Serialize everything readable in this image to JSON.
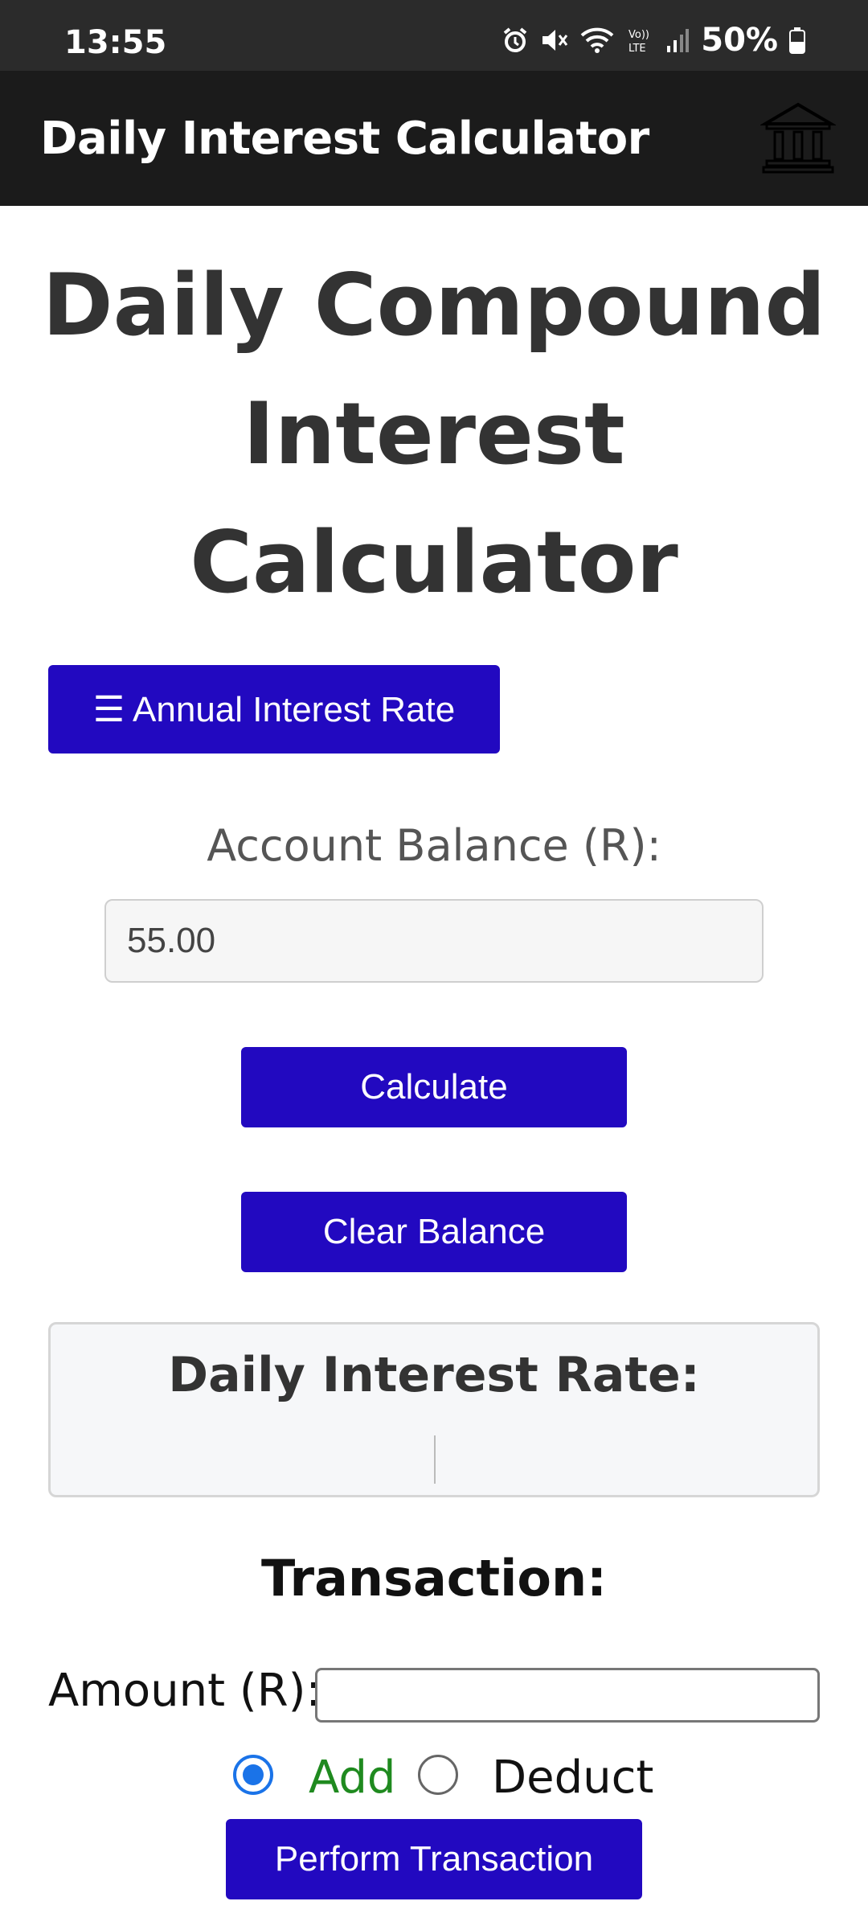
{
  "status_bar": {
    "time": "13:55",
    "battery": "50%",
    "icons": [
      "alarm-icon",
      "mute-icon",
      "wifi-icon",
      "volte-icon",
      "signal-icon",
      "battery-icon"
    ]
  },
  "app_bar": {
    "title": "Daily Interest Calculator",
    "icon": "bank-icon"
  },
  "main": {
    "title": "Daily Compound Interest Calculator",
    "rate_menu_button": "☰ Annual Interest Rate",
    "balance_label": "Account Balance (R):",
    "balance_value": "55.00",
    "calculate_button": "Calculate",
    "clear_button": "Clear Balance",
    "rate_box_title": "Daily Interest Rate:",
    "rate_box_value": ""
  },
  "transaction": {
    "title": "Transaction:",
    "amount_label": "Amount (R):",
    "amount_value": "",
    "add_label": "Add",
    "deduct_label": "Deduct",
    "selected": "Add",
    "perform_button": "Perform Transaction"
  },
  "colors": {
    "accent": "#2209c0",
    "app_bar": "#1b1b1b",
    "status_bar": "#2b2b2b",
    "add_label": "#1f8a1f",
    "radio_selected": "#1a73e8"
  }
}
